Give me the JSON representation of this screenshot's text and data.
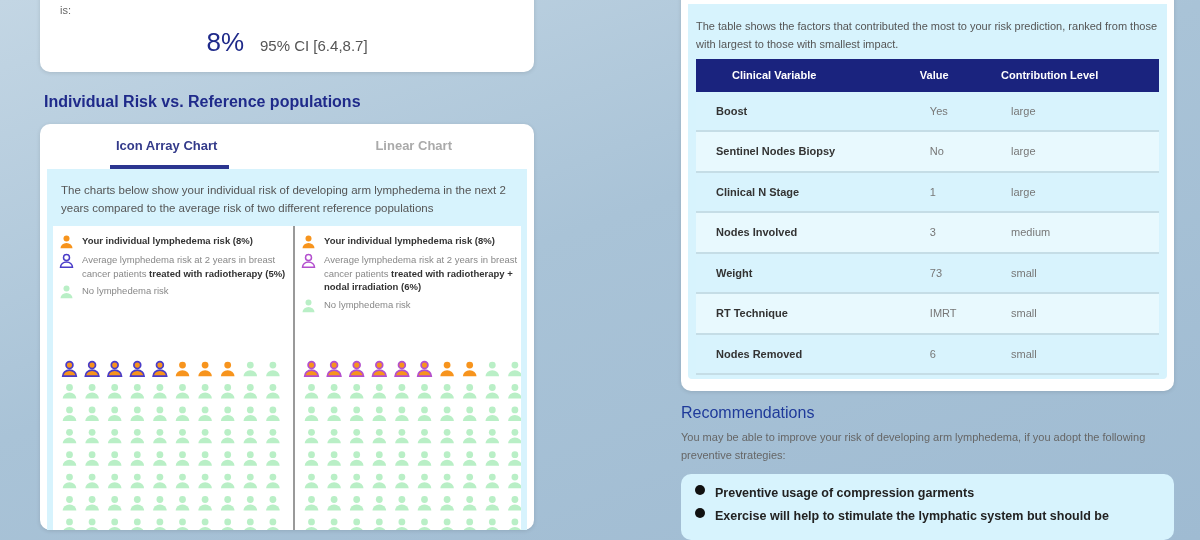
{
  "risk_card": {
    "intro": "is:",
    "risk_value": "8%",
    "confidence_interval": "95% CI [6.4,8.7]"
  },
  "comparison": {
    "heading": "Individual Risk vs. Reference populations",
    "tabs": [
      {
        "label": "Icon Array Chart",
        "selected": true
      },
      {
        "label": "Linear Chart",
        "selected": false
      }
    ],
    "description": "The charts below show your individual risk of developing arm lymphedema in the next 2 years compared to the average risk of two different reference populations",
    "icon_arrays": [
      {
        "legend": [
          {
            "kind": "individual",
            "color": "#f7941d",
            "text": "Your individual lymphedema risk (8%)"
          },
          {
            "kind": "reference",
            "color": "#4a3cc8",
            "text": "Average lymphedema risk at 2 years in breast cancer patients **treated with radiotherapy (5%)**"
          },
          {
            "kind": "none",
            "color": "#b9efc6",
            "text": "No lymphedema risk"
          }
        ],
        "first_row": [
          {
            "kind": "reference"
          },
          {
            "kind": "reference"
          },
          {
            "kind": "reference"
          },
          {
            "kind": "reference"
          },
          {
            "kind": "reference"
          },
          {
            "kind": "individual"
          },
          {
            "kind": "individual"
          },
          {
            "kind": "individual"
          },
          {
            "kind": "none"
          },
          {
            "kind": "none"
          }
        ]
      },
      {
        "legend": [
          {
            "kind": "individual",
            "color": "#f7941d",
            "text": "Your individual lymphedema risk (8%)"
          },
          {
            "kind": "reference",
            "color": "#b34fce",
            "text": "Average lymphedema risk at 2 years in breast cancer patients **treated with radiotherapy + nodal irradiation (6%)**"
          },
          {
            "kind": "none",
            "color": "#b9efc6",
            "text": "No lymphedema risk"
          }
        ],
        "first_row": [
          {
            "kind": "reference"
          },
          {
            "kind": "reference"
          },
          {
            "kind": "reference"
          },
          {
            "kind": "reference"
          },
          {
            "kind": "reference"
          },
          {
            "kind": "reference"
          },
          {
            "kind": "individual"
          },
          {
            "kind": "individual"
          },
          {
            "kind": "none"
          },
          {
            "kind": "none"
          }
        ]
      }
    ]
  },
  "factors": {
    "description": "The table shows the factors that contributed the most to your risk prediction, ranked from those with largest to those with smallest impact.",
    "table": {
      "columns": [
        "Clinical Variable",
        "Value",
        "Contribution Level"
      ],
      "rows": [
        [
          "Boost",
          "Yes",
          "large"
        ],
        [
          "Sentinel Nodes Biopsy",
          "No",
          "large"
        ],
        [
          "Clinical N Stage",
          "1",
          "large"
        ],
        [
          "Nodes Involved",
          "3",
          "medium"
        ],
        [
          "Weight",
          "73",
          "small"
        ],
        [
          "RT Technique",
          "IMRT",
          "small"
        ],
        [
          "Nodes Removed",
          "6",
          "small"
        ]
      ]
    }
  },
  "recommendations": {
    "heading": "Recommendations",
    "intro": "You may be able to improve your risk of developing arm lymphedema, if you adopt the following preventive strategies:",
    "items": [
      "Preventive usage of compression garments",
      "Exercise will help to stimulate the lymphatic system but should be"
    ]
  }
}
